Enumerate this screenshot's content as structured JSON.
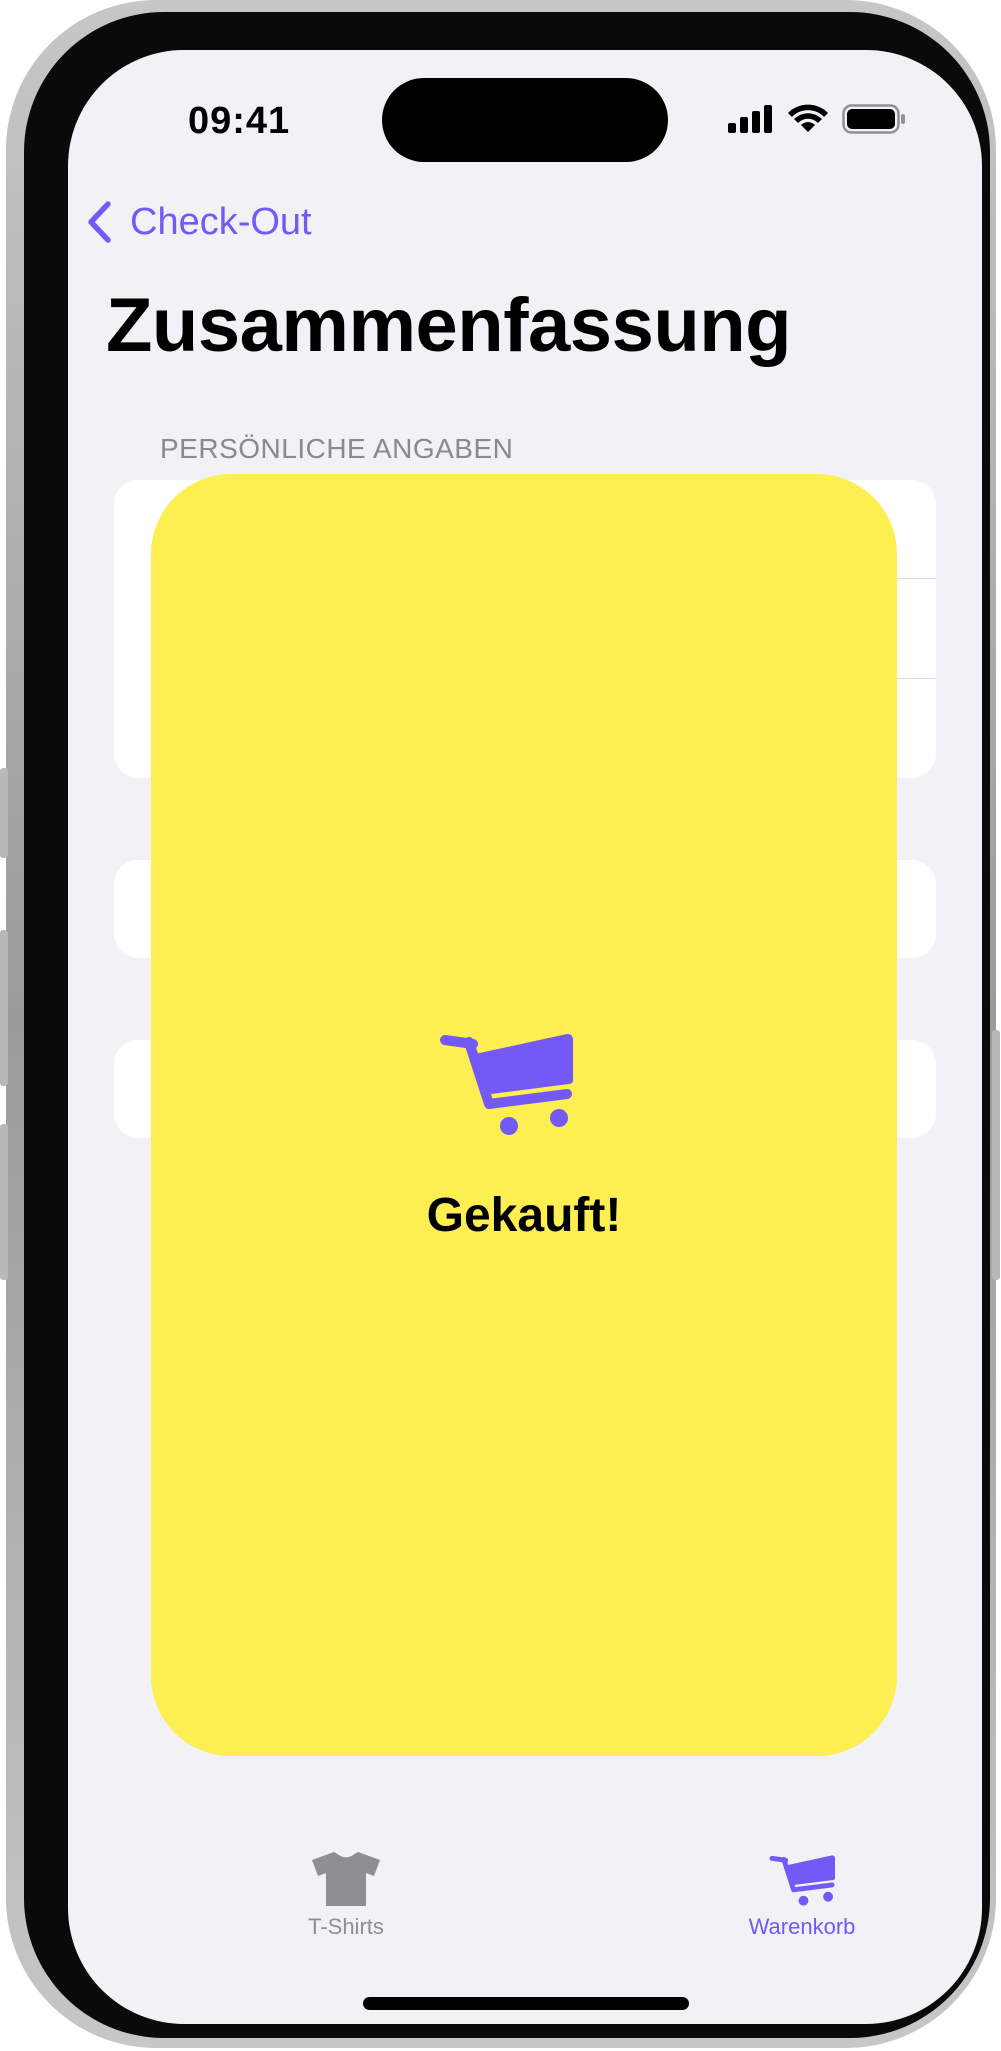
{
  "status_bar": {
    "time": "09:41"
  },
  "nav": {
    "back_label": "Check-Out"
  },
  "page": {
    "title": "Zusammenfassung"
  },
  "sections": {
    "personal_header": "PERSÖNLICHE ANGABEN"
  },
  "overlay": {
    "message": "Gekauft!",
    "icon": "cart-icon",
    "background": "#fdee52"
  },
  "tab_bar": {
    "items": [
      {
        "label": "T-Shirts",
        "icon": "tshirt-icon",
        "selected": false
      },
      {
        "label": "Warenkorb",
        "icon": "cart-icon",
        "selected": true
      }
    ]
  },
  "colors": {
    "accent": "#7359f5",
    "inactive": "#8e8e93",
    "background": "#f2f1f6",
    "sheet": "#fdee52"
  }
}
